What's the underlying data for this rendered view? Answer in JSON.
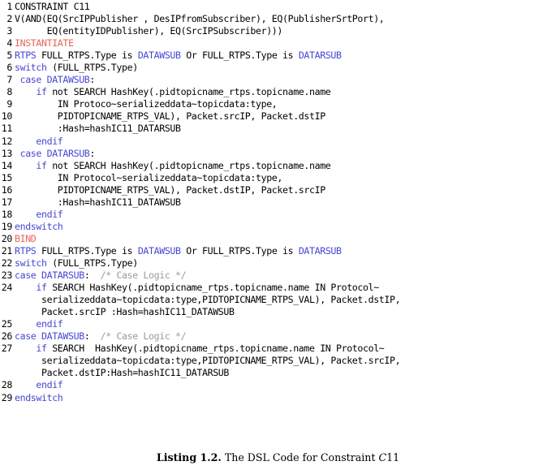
{
  "listing": {
    "lines": [
      {
        "n": "1",
        "segments": [
          {
            "t": "CONSTRAINT C11",
            "c": "pl"
          }
        ]
      },
      {
        "n": "2",
        "segments": [
          {
            "t": "V(AND(EQ(SrcIPPublisher , DesIPfromSubscriber), EQ(PublisherSrtPort),",
            "c": "pl"
          }
        ]
      },
      {
        "n": "3",
        "segments": [
          {
            "t": "      EQ(entityIDPublisher), EQ(SrcIPSubscriber)))",
            "c": "pl"
          }
        ]
      },
      {
        "n": "4",
        "segments": [
          {
            "t": "INSTANTIATE",
            "c": "red"
          }
        ]
      },
      {
        "n": "5",
        "segments": [
          {
            "t": "RTPS",
            "c": "kw"
          },
          {
            "t": " FULL_RTPS.Type is ",
            "c": "pl"
          },
          {
            "t": "DATAWSUB",
            "c": "kw"
          },
          {
            "t": " Or FULL_RTPS.Type is ",
            "c": "pl"
          },
          {
            "t": "DATARSUB",
            "c": "kw"
          }
        ]
      },
      {
        "n": "6",
        "segments": [
          {
            "t": "switch",
            "c": "kw"
          },
          {
            "t": " (FULL_RTPS.Type)",
            "c": "pl"
          }
        ]
      },
      {
        "n": "7",
        "segments": [
          {
            "t": " ",
            "c": "pl"
          },
          {
            "t": "case DATAWSUB",
            "c": "kw"
          },
          {
            "t": ":",
            "c": "pl"
          }
        ]
      },
      {
        "n": "8",
        "segments": [
          {
            "t": "    ",
            "c": "pl"
          },
          {
            "t": "if",
            "c": "kw"
          },
          {
            "t": " not SEARCH HashKey(.pidtopicname_rtps.topicname.name",
            "c": "pl"
          }
        ]
      },
      {
        "n": "9",
        "segments": [
          {
            "t": "        IN Protoco~serializeddata~topicdata:type,",
            "c": "pl"
          }
        ]
      },
      {
        "n": "10",
        "segments": [
          {
            "t": "        PIDTOPICNAME_RTPS_VAL), Packet.srcIP, Packet.dstIP",
            "c": "pl"
          }
        ]
      },
      {
        "n": "11",
        "segments": [
          {
            "t": "        :Hash=hashIC11_DATARSUB",
            "c": "pl"
          }
        ]
      },
      {
        "n": "12",
        "segments": [
          {
            "t": "    ",
            "c": "pl"
          },
          {
            "t": "endif",
            "c": "kw"
          }
        ]
      },
      {
        "n": "13",
        "segments": [
          {
            "t": " ",
            "c": "pl"
          },
          {
            "t": "case DATARSUB",
            "c": "kw"
          },
          {
            "t": ":",
            "c": "pl"
          }
        ]
      },
      {
        "n": "14",
        "segments": [
          {
            "t": "    ",
            "c": "pl"
          },
          {
            "t": "if",
            "c": "kw"
          },
          {
            "t": " not SEARCH HashKey(.pidtopicname_rtps.topicname.name",
            "c": "pl"
          }
        ]
      },
      {
        "n": "15",
        "segments": [
          {
            "t": "        IN Protocol~serializeddata~topicdata:type,",
            "c": "pl"
          }
        ]
      },
      {
        "n": "16",
        "segments": [
          {
            "t": "        PIDTOPICNAME_RTPS_VAL), Packet.dstIP, Packet.srcIP",
            "c": "pl"
          }
        ]
      },
      {
        "n": "17",
        "segments": [
          {
            "t": "        :Hash=hashIC11_DATAWSUB",
            "c": "pl"
          }
        ]
      },
      {
        "n": "18",
        "segments": [
          {
            "t": "    ",
            "c": "pl"
          },
          {
            "t": "endif",
            "c": "kw"
          }
        ]
      },
      {
        "n": "19",
        "segments": [
          {
            "t": "endswitch",
            "c": "kw"
          }
        ]
      },
      {
        "n": "20",
        "segments": [
          {
            "t": "BIND",
            "c": "red"
          }
        ]
      },
      {
        "n": "21",
        "segments": [
          {
            "t": "RTPS",
            "c": "kw"
          },
          {
            "t": " FULL_RTPS.Type is ",
            "c": "pl"
          },
          {
            "t": "DATAWSUB",
            "c": "kw"
          },
          {
            "t": " Or FULL_RTPS.Type is ",
            "c": "pl"
          },
          {
            "t": "DATARSUB",
            "c": "kw"
          }
        ]
      },
      {
        "n": "22",
        "segments": [
          {
            "t": "switch",
            "c": "kw"
          },
          {
            "t": " (FULL_RTPS.Type)",
            "c": "pl"
          }
        ]
      },
      {
        "n": "23",
        "segments": [
          {
            "t": "case DATARSUB",
            "c": "kw"
          },
          {
            "t": ":  ",
            "c": "pl"
          },
          {
            "t": "/* Case Logic */",
            "c": "cmt"
          }
        ]
      },
      {
        "n": "24",
        "segments": [
          {
            "t": "    ",
            "c": "pl"
          },
          {
            "t": "if",
            "c": "kw"
          },
          {
            "t": " SEARCH HashKey(.pidtopicname_rtps.topicname.name IN Protocol~",
            "c": "pl"
          }
        ]
      },
      {
        "n": "",
        "segments": [
          {
            "t": "     serializeddata~topicdata:type,PIDTOPICNAME_RTPS_VAL), Packet.dstIP,",
            "c": "pl"
          }
        ]
      },
      {
        "n": "",
        "segments": [
          {
            "t": "     Packet.srcIP :Hash=hashIC11_DATAWSUB",
            "c": "pl"
          }
        ]
      },
      {
        "n": "25",
        "segments": [
          {
            "t": "    ",
            "c": "pl"
          },
          {
            "t": "endif",
            "c": "kw"
          }
        ]
      },
      {
        "n": "26",
        "segments": [
          {
            "t": "case DATAWSUB",
            "c": "kw"
          },
          {
            "t": ":  ",
            "c": "pl"
          },
          {
            "t": "/* Case Logic */",
            "c": "cmt"
          }
        ]
      },
      {
        "n": "27",
        "segments": [
          {
            "t": "    ",
            "c": "pl"
          },
          {
            "t": "if",
            "c": "kw"
          },
          {
            "t": " SEARCH  HashKey(.pidtopicname_rtps.topicname.name IN Protocol~",
            "c": "pl"
          }
        ]
      },
      {
        "n": "",
        "segments": [
          {
            "t": "     serializeddata~topicdata:type,PIDTOPICNAME_RTPS_VAL), Packet.srcIP,",
            "c": "pl"
          }
        ]
      },
      {
        "n": "",
        "segments": [
          {
            "t": "     Packet.dstIP:Hash=hashIC11_DATARSUB",
            "c": "pl"
          }
        ]
      },
      {
        "n": "28",
        "segments": [
          {
            "t": "    ",
            "c": "pl"
          },
          {
            "t": "endif",
            "c": "kw"
          }
        ]
      },
      {
        "n": "29",
        "segments": [
          {
            "t": "endswitch",
            "c": "kw"
          }
        ]
      }
    ]
  },
  "caption": {
    "label": "Listing 1.2.",
    "text_before": " The DSL Code for Constraint ",
    "italic_symbol": "C",
    "text_after": "11"
  },
  "colors": {
    "keyword": "#4646d2",
    "marker": "#e8645a",
    "comment": "#9a9a9a",
    "plain": "#000000",
    "background": "#ffffff"
  }
}
